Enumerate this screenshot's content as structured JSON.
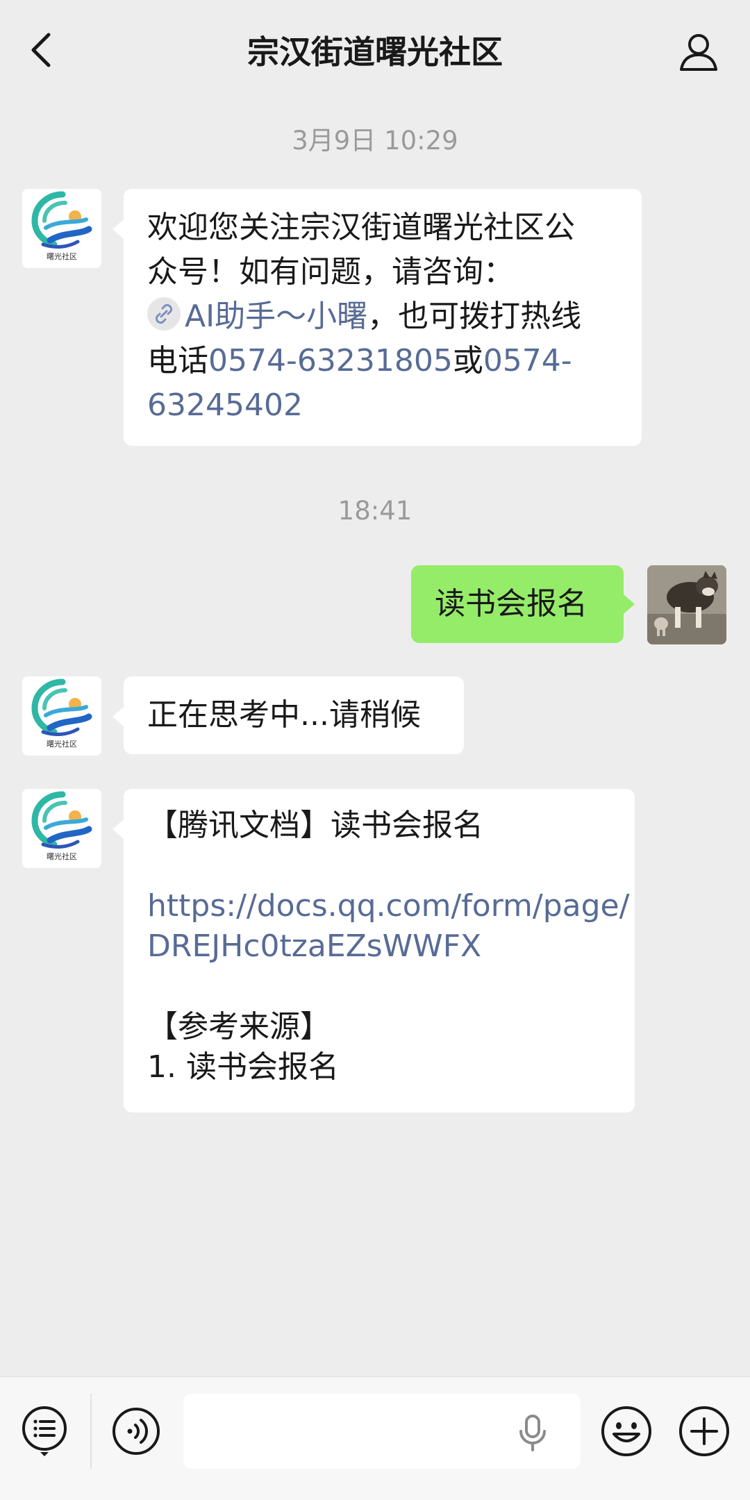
{
  "header": {
    "title": "宗汉街道曙光社区"
  },
  "messages": {
    "time1": "3月9日 10:29",
    "welcome": {
      "line1": "欢迎您关注宗汉街道曙光社区公",
      "line2": "众号！如有问题，请咨询：",
      "assistant": "AI助手～小曙",
      "line3_tail": "，也可拨打热线",
      "line4_prefix": "电话",
      "phone1": "0574-63231805",
      "or": "或",
      "phone2_a": "0574-",
      "phone2_b": "63245402"
    },
    "time2": "18:41",
    "user_msg": "读书会报名",
    "thinking": "正在思考中...请稍候",
    "reply": {
      "title": "【腾讯文档】读书会报名",
      "url_1": "https://docs.qq.com/form/page/",
      "url_2": "DREJHc0tzaEZsWWFX",
      "ref_title": "【参考来源】",
      "ref_item": "1. 读书会报名"
    }
  },
  "logo": {
    "text": "曙光社区"
  },
  "colors": {
    "background": "#ededed",
    "user_bubble": "#95ec69",
    "link": "#576b95",
    "timestamp": "#9a9a9a"
  },
  "icons": {
    "back": "chevron-left-icon",
    "profile": "person-icon",
    "menu": "list-menu-icon",
    "voice": "voice-icon",
    "mic": "microphone-icon",
    "emoji": "emoji-icon",
    "plus": "plus-icon"
  }
}
